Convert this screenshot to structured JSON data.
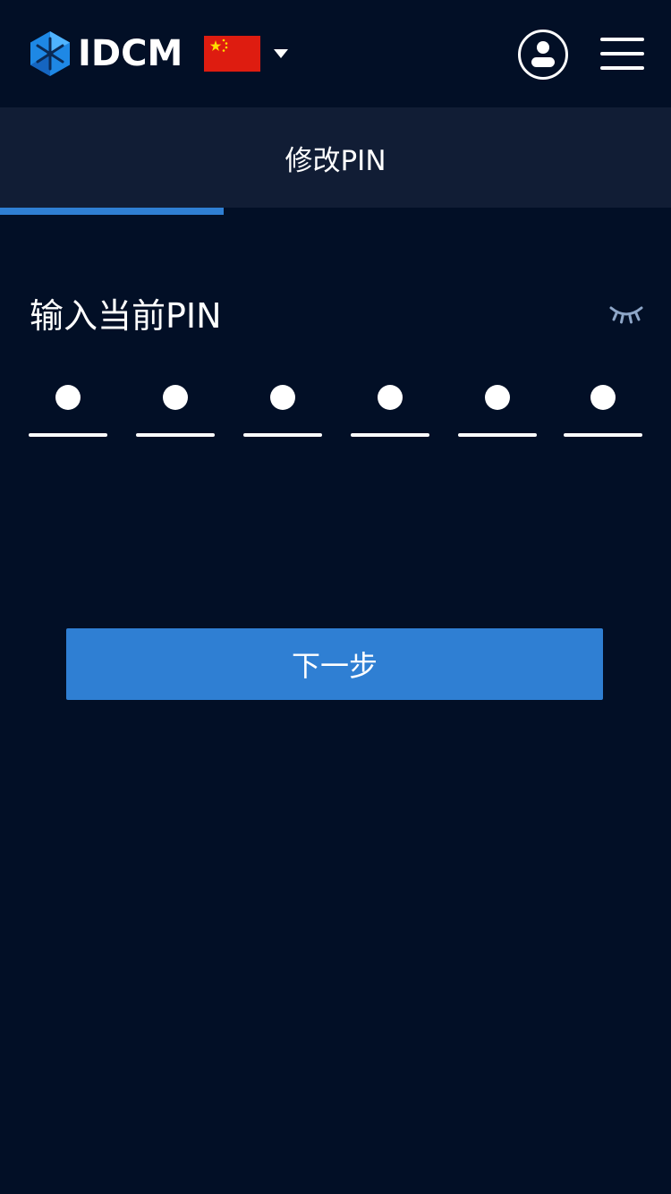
{
  "header": {
    "logo_text": "IDCM",
    "language_flag": "china-flag",
    "language_dropdown_icon": "caret-down-icon",
    "user_icon": "user-icon",
    "menu_icon": "hamburger-menu-icon"
  },
  "tabs": [
    {
      "label": "修改PIN",
      "active": true
    }
  ],
  "progress": {
    "step_fraction": 0.333
  },
  "pin": {
    "label": "输入当前PIN",
    "visibility_icon": "eye-closed-icon",
    "length": 6,
    "filled": 6
  },
  "actions": {
    "next_label": "下一步"
  },
  "colors": {
    "background": "#020f26",
    "tab_background": "#111d35",
    "accent": "#2f7fd3",
    "logo_blue": "#1e88e5",
    "flag_red": "#de1c10",
    "flag_yellow": "#ffde00"
  }
}
